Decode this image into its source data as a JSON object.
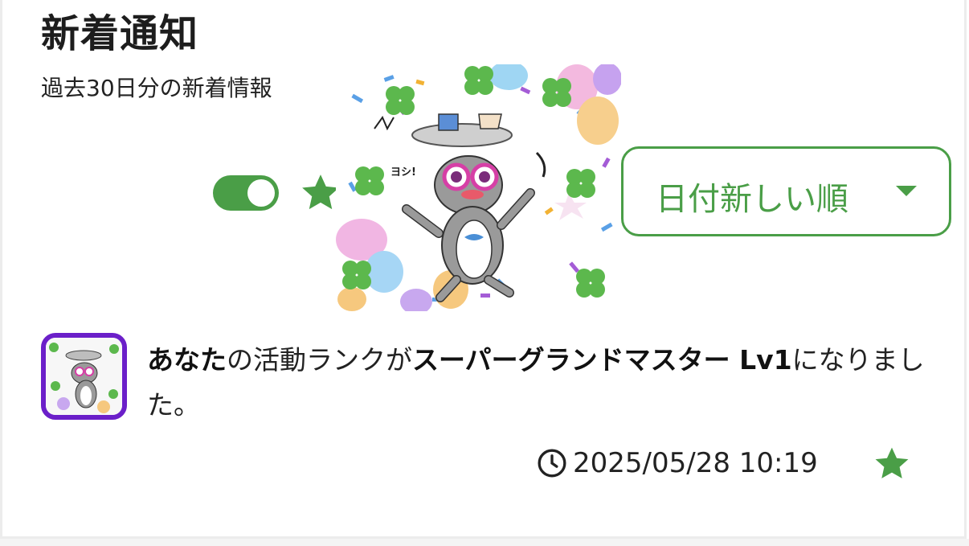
{
  "header": {
    "title": "新着通知",
    "subtitle": "過去30日分の新着情報"
  },
  "filters": {
    "toggle_state": "on",
    "star_icon": "star-icon"
  },
  "sort": {
    "selected_label": "日付新しい順",
    "caret_icon": "chevron-down-icon"
  },
  "notification": {
    "message": {
      "part1": "あなた",
      "part2": "の活動ランクが",
      "part3": "スーパーグランドマスター Lv1",
      "part4": "になりました。"
    },
    "timestamp": "2025/05/28 10:19",
    "clock_icon": "clock-icon",
    "star_icon": "star-icon"
  },
  "colors": {
    "accent": "#4a9e47",
    "avatar_border": "#6b1fc9",
    "text": "#222222"
  }
}
